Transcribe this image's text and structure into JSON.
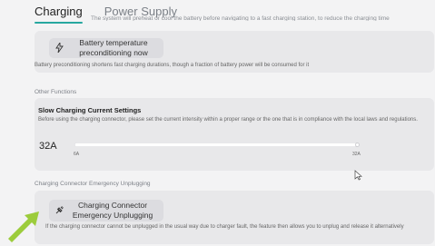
{
  "tabs": [
    {
      "label": "Charging",
      "active": true
    },
    {
      "label": "Power Supply",
      "active": false
    }
  ],
  "cut_text": "The system will preheat or cool the battery before navigating to a fast charging station, to reduce the charging time",
  "battery": {
    "button_label": "Battery temperature\npreconditioning now",
    "note": "Battery preconditioning shortens fast charging durations, though a fraction of battery power will be consumed for it"
  },
  "other_functions": {
    "label": "Other Functions",
    "slow_charging": {
      "title": "Slow Charging Current Settings",
      "description": "Before using the charging connector, please set the current intensity within a proper range or the one that is in compliance with the local laws and regulations.",
      "value": "32A",
      "min_label": "6A",
      "max_label": "32A",
      "level": 1.0
    }
  },
  "emergency": {
    "label": "Charging Connector Emergency Unplugging",
    "button_label": "Charging Connector\nEmergency Unplugging",
    "note": "If the charging connector cannot be unplugged in the usual way due to charger fault, the feature then allows you to unplug and release it alternatively"
  },
  "colors": {
    "accent": "#27a8a0",
    "arrow": "#9ccc3c",
    "background": "#f3f3f4",
    "card": "#e8e8ea"
  },
  "icons": {
    "battery_button": "lightning-bolt-icon",
    "emergency_button": "plug-icon",
    "cursor": "mouse-pointer-icon",
    "pointer_arrow": "green-arrow-icon"
  }
}
